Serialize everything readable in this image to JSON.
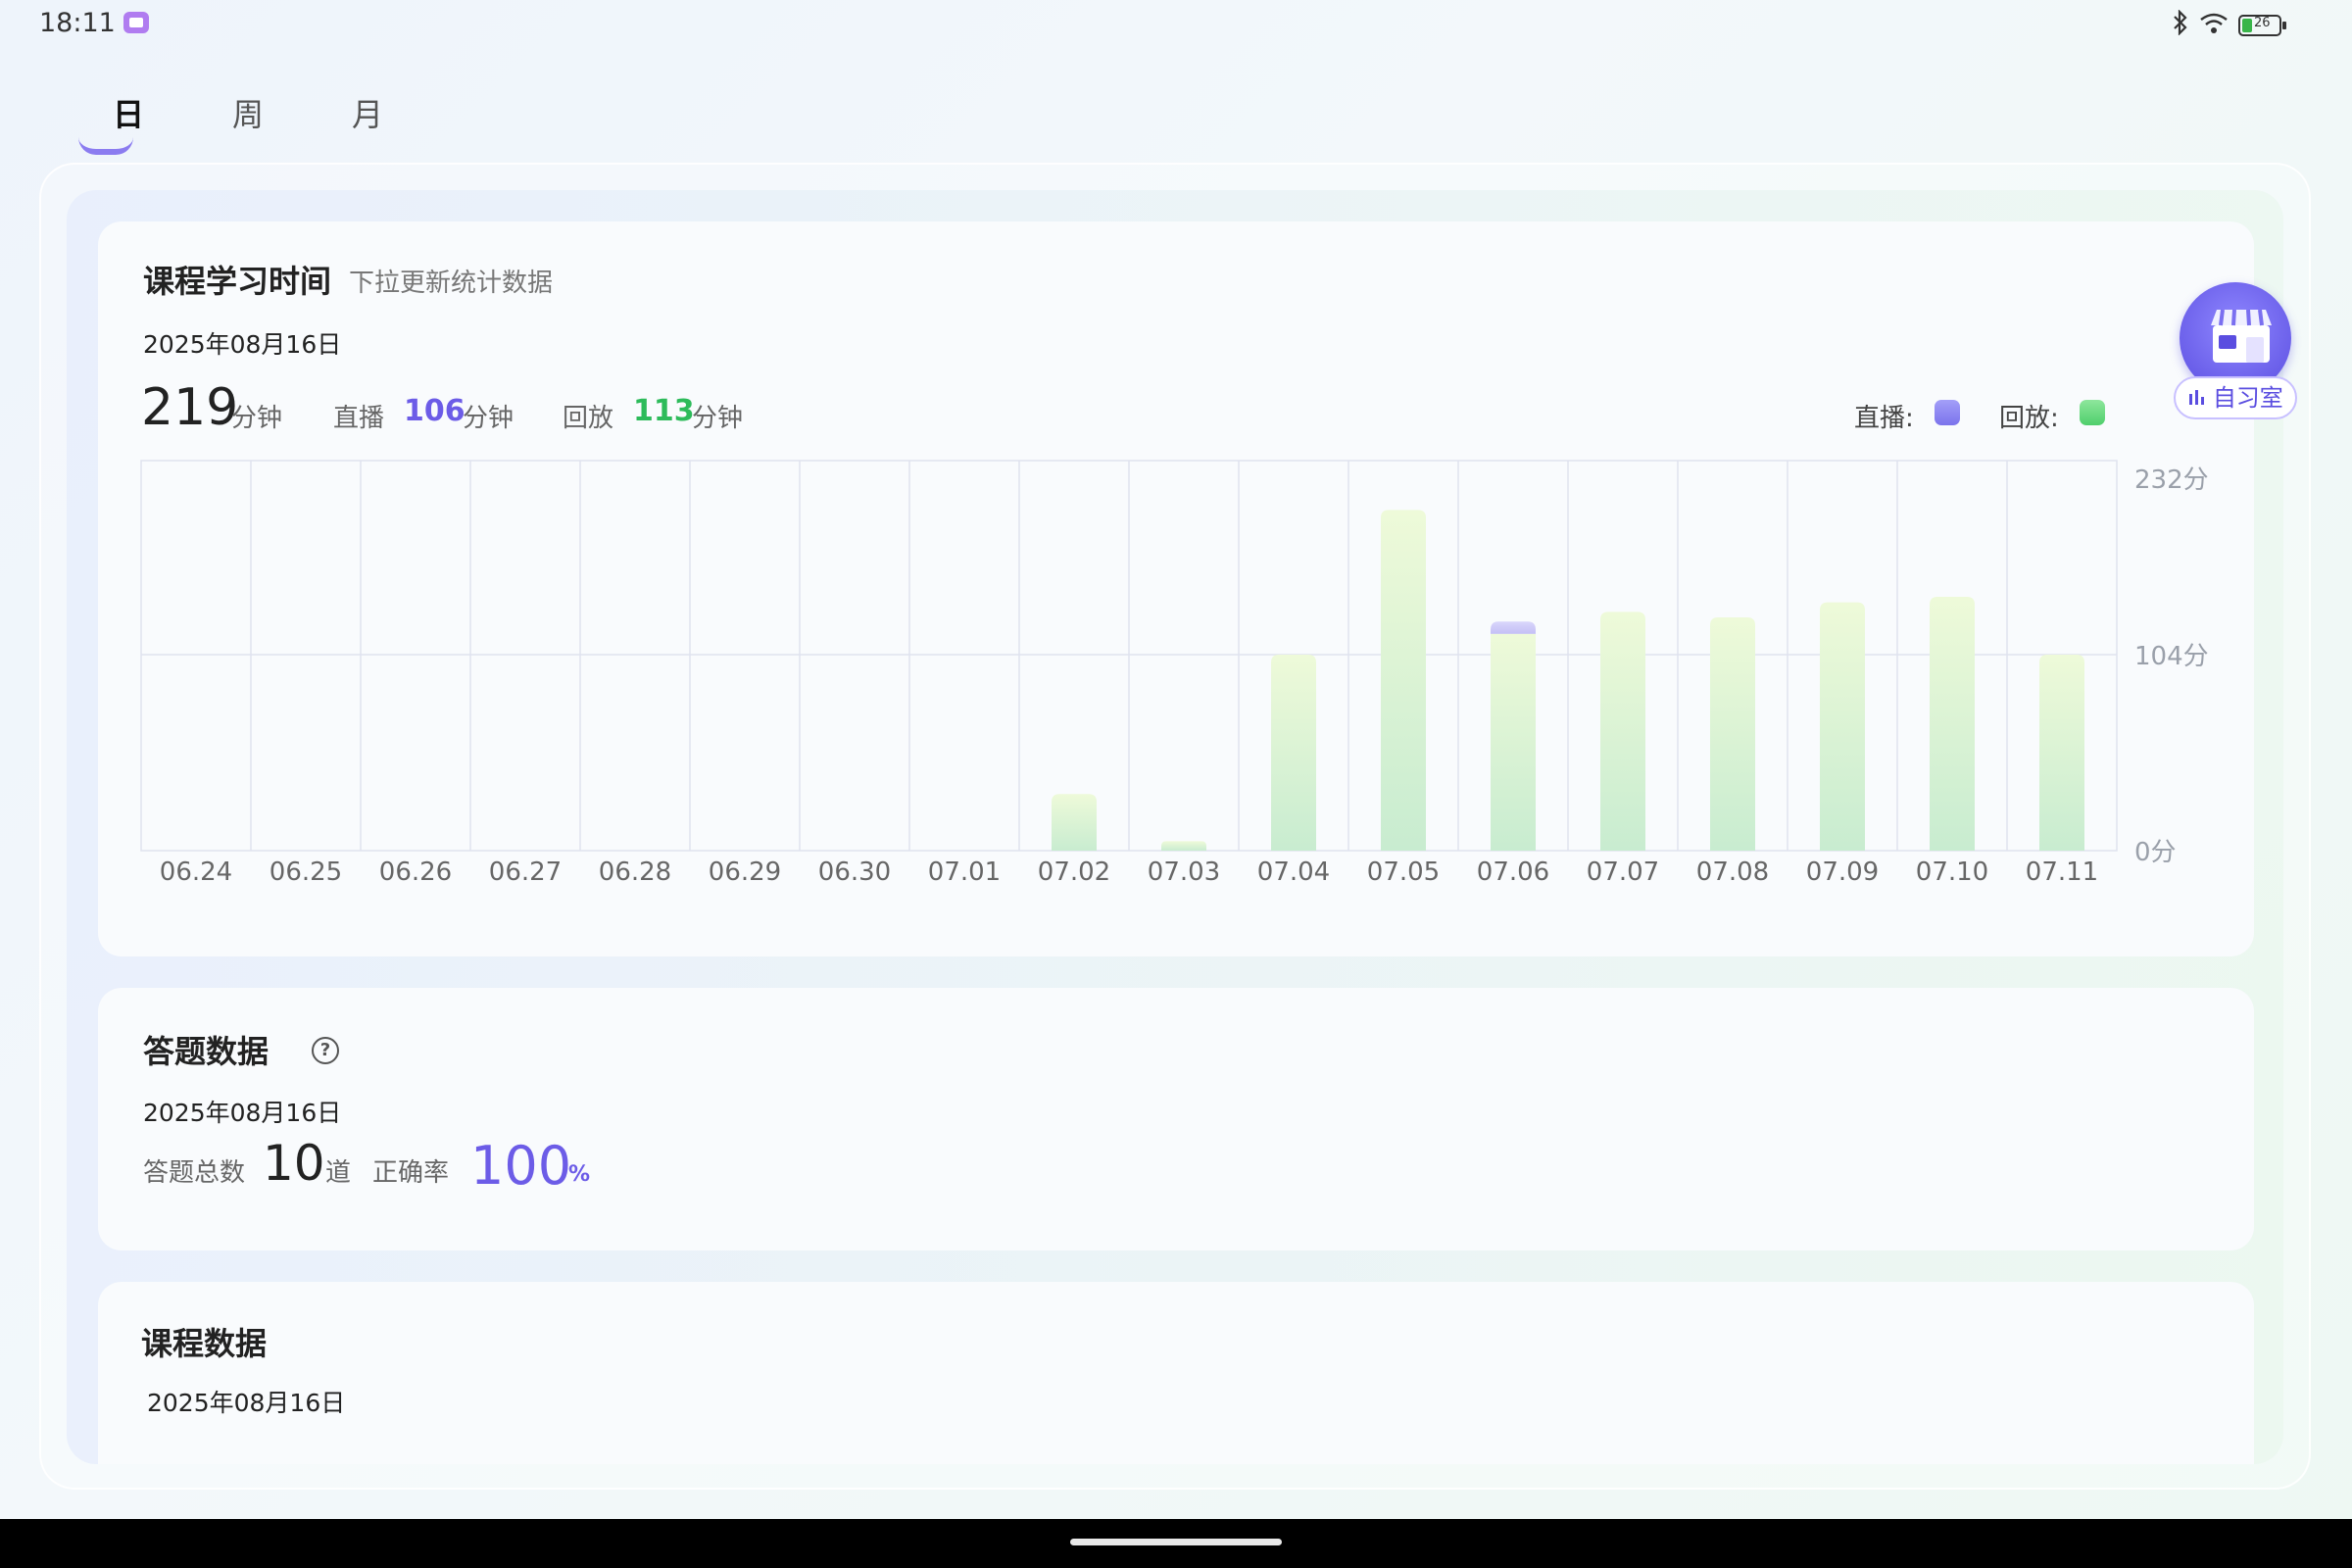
{
  "status_bar": {
    "time": "18:11",
    "icons": [
      "video-app-icon",
      "bluetooth-icon",
      "wifi-icon",
      "battery-icon"
    ],
    "battery_level": "26"
  },
  "tabs": [
    {
      "label": "日",
      "active": true
    },
    {
      "label": "周",
      "active": false
    },
    {
      "label": "月",
      "active": false
    }
  ],
  "study_time": {
    "title": "课程学习时间",
    "subtitle": "下拉更新统计数据",
    "date": "2025年08月16日",
    "total": "219",
    "total_unit": "分钟",
    "live_label": "直播",
    "live_value": "106",
    "live_unit": "分钟",
    "replay_label": "回放",
    "replay_value": "113",
    "replay_unit": "分钟",
    "legend_live": "直播:",
    "legend_replay": "回放:",
    "colors": {
      "live": "#8a84f5",
      "replay": "#5fd47e"
    }
  },
  "chart_data": {
    "type": "bar",
    "stacked": true,
    "categories": [
      "06.24",
      "06.25",
      "06.26",
      "06.27",
      "06.28",
      "06.29",
      "06.30",
      "07.01",
      "07.02",
      "07.03",
      "07.04",
      "07.05",
      "07.06",
      "07.07",
      "07.08",
      "07.09",
      "07.10",
      "07.11"
    ],
    "series": [
      {
        "name": "回放",
        "values": [
          0,
          0,
          0,
          0,
          0,
          0,
          0,
          0,
          30,
          5,
          104,
          209,
          119,
          135,
          131,
          142,
          146,
          104
        ]
      },
      {
        "name": "直播",
        "values": [
          0,
          0,
          0,
          0,
          0,
          0,
          0,
          0,
          0,
          0,
          0,
          0,
          9,
          0,
          0,
          0,
          0,
          0
        ]
      }
    ],
    "y_ticks": [
      "232分",
      "104分",
      "0分"
    ],
    "y_tick_values": [
      232,
      104,
      0
    ],
    "ylim": [
      0,
      232
    ],
    "grid": true
  },
  "self_study": {
    "label": "自习室"
  },
  "answers": {
    "title": "答题数据",
    "date": "2025年08月16日",
    "total_label": "答题总数",
    "total_value": "10",
    "total_unit": "道",
    "accuracy_label": "正确率",
    "accuracy_value": "100",
    "accuracy_unit": "%"
  },
  "course": {
    "title": "课程数据",
    "date": "2025年08月16日"
  }
}
